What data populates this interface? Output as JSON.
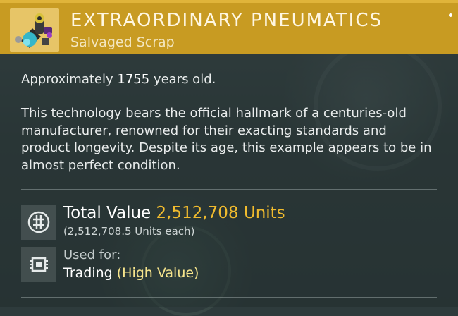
{
  "item": {
    "title": "EXTRAORDINARY PNEUMATICS",
    "subtitle": "Salvaged Scrap",
    "icon": "pneumatics-item-icon"
  },
  "details": {
    "age_prefix": "Approximately",
    "age_value": "1755",
    "age_suffix": "years old.",
    "description": "This technology bears the official hallmark of a centuries-old manufacturer, renowned for their exacting standards and product longevity. Despite its age, this example appears to be in almost perfect condition."
  },
  "value": {
    "label": "Total Value",
    "amount": "2,512,708 Units",
    "each": "(2,512,708.5 Units each)",
    "icon": "units-currency-icon"
  },
  "usage": {
    "label": "Used for:",
    "use": "Trading",
    "quality": "(High Value)",
    "icon": "trade-chip-icon"
  },
  "colors": {
    "header": "#c89b22",
    "value_accent": "#f0bb2e",
    "quality_accent": "#f6e48c"
  }
}
